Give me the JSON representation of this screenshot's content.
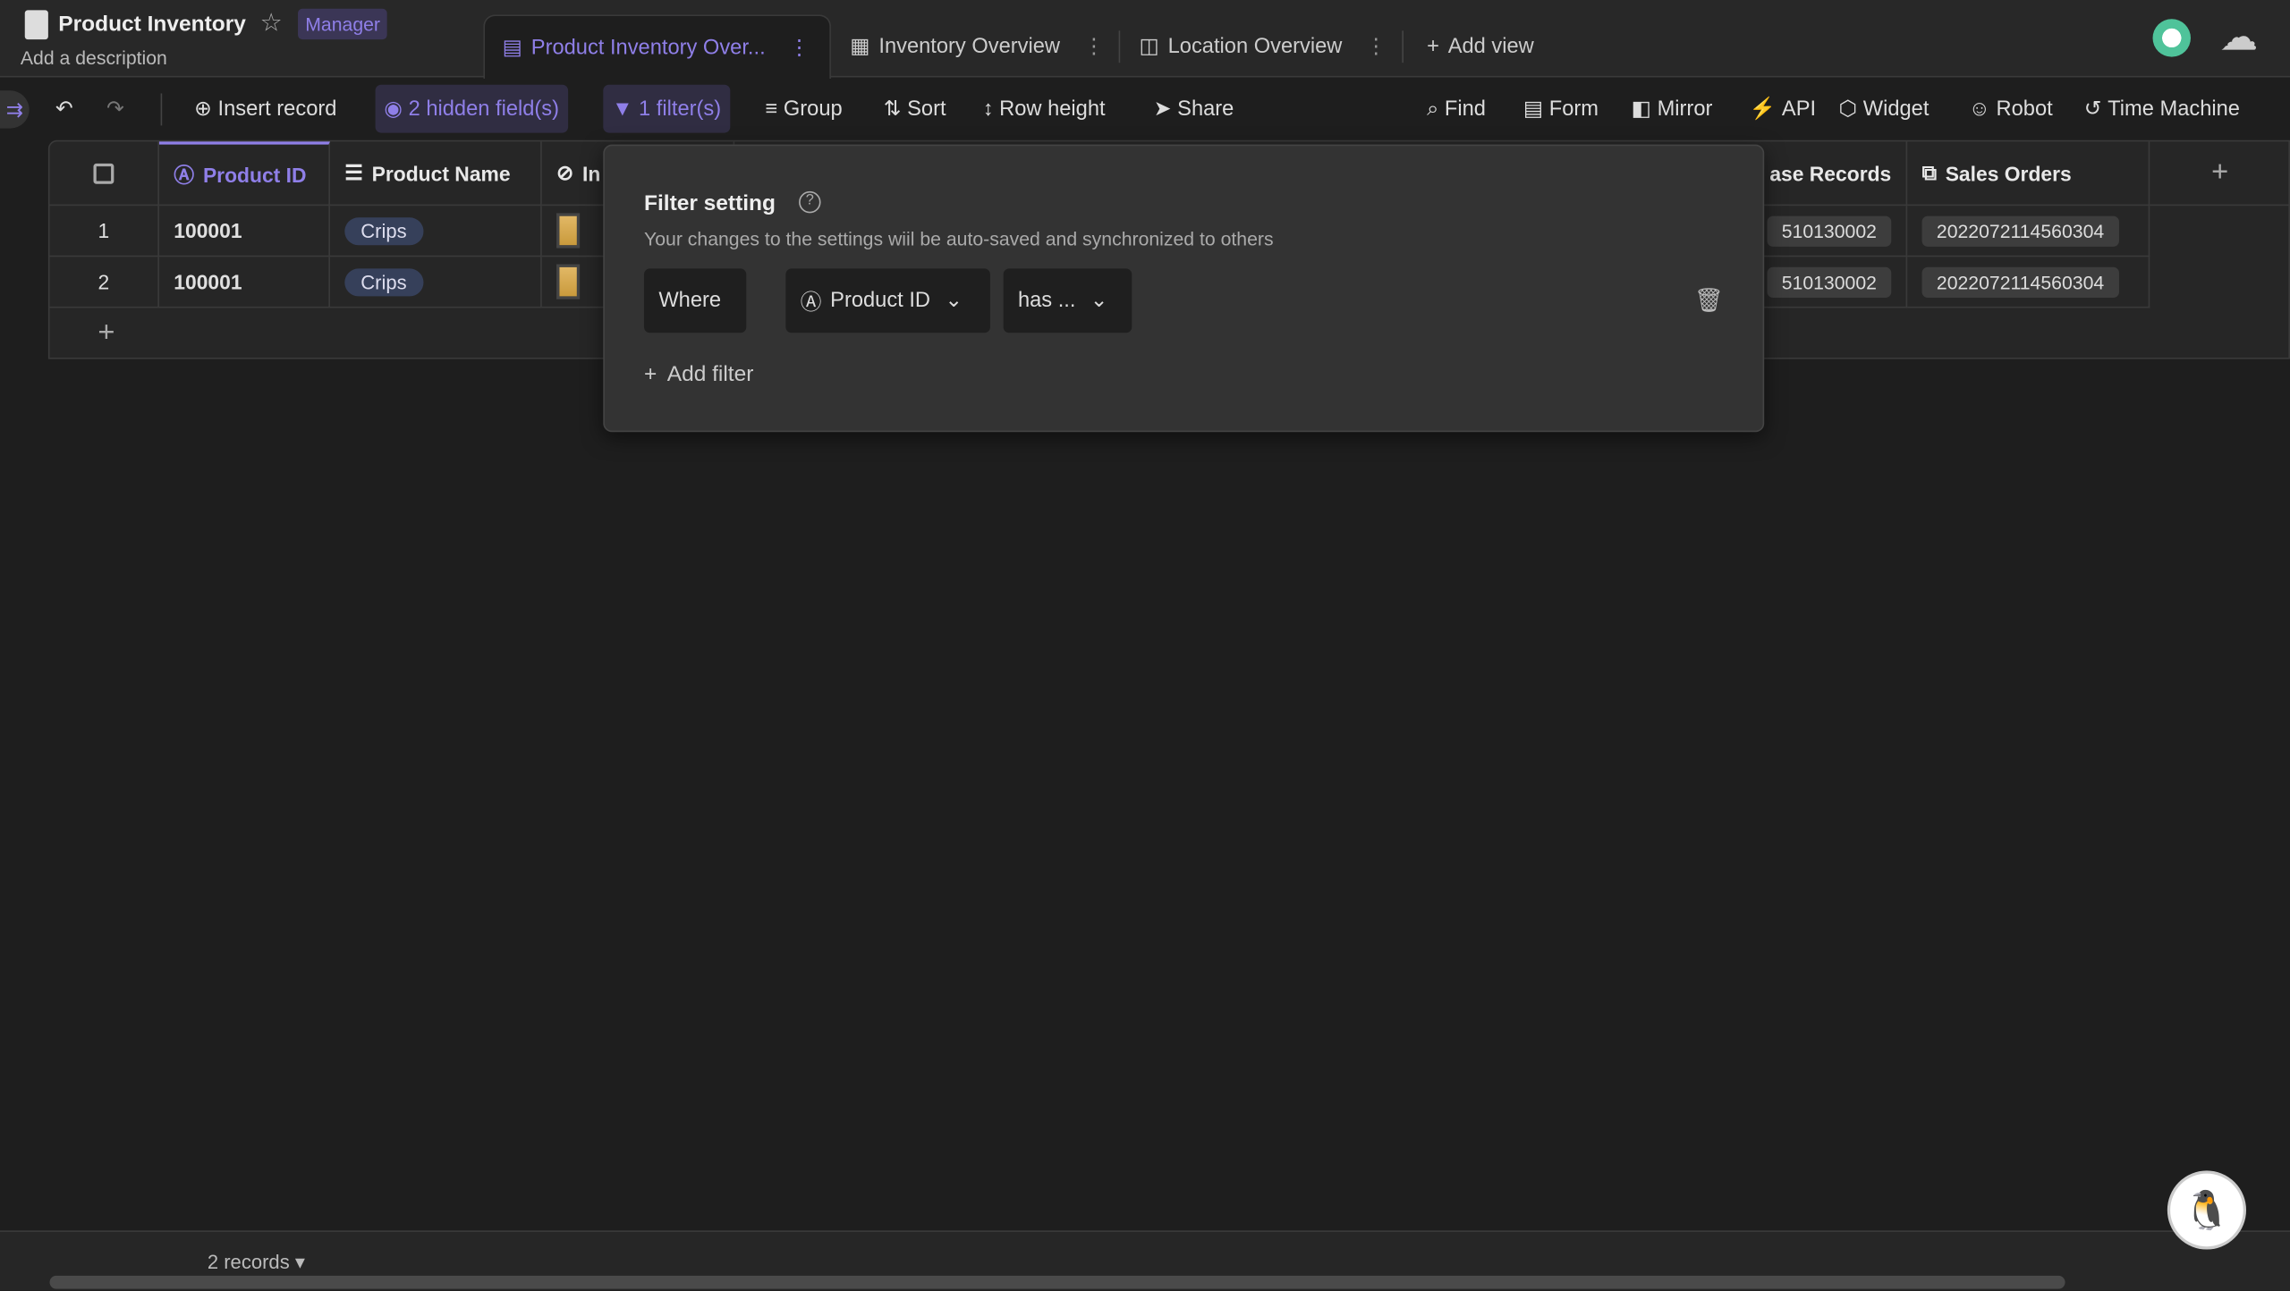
{
  "header": {
    "title": "Product Inventory",
    "role_badge": "Manager",
    "description": "Add a description"
  },
  "views": [
    {
      "label": "Product Inventory Over...",
      "active": true,
      "icon": "grid-view-icon"
    },
    {
      "label": "Inventory Overview",
      "icon": "gallery-view-icon"
    },
    {
      "label": "Location Overview",
      "icon": "kanban-view-icon"
    }
  ],
  "add_view": "Add view",
  "toolbar": {
    "insert": "Insert record",
    "hidden": "2 hidden field(s)",
    "filter": "1 filter(s)",
    "group": "Group",
    "sort": "Sort",
    "row_height": "Row height",
    "share": "Share",
    "find": "Find",
    "form": "Form",
    "mirror": "Mirror",
    "api": "API",
    "widget": "Widget",
    "robot": "Robot",
    "time_machine": "Time Machine"
  },
  "table": {
    "columns": [
      "Product ID",
      "Product Name",
      "In",
      "ase Records",
      "Sales Orders"
    ],
    "rows": [
      {
        "num": "1",
        "id": "100001",
        "name": "Crips",
        "purchase": "510130002",
        "sales": "2022072114560304"
      },
      {
        "num": "2",
        "id": "100001",
        "name": "Crips",
        "purchase": "510130002",
        "sales": "2022072114560304"
      }
    ]
  },
  "filter_popup": {
    "title": "Filter setting",
    "subtitle": "Your changes to the settings wiil be auto-saved and synchronized to others",
    "where": "Where",
    "field": "Product ID",
    "operator": "has ...",
    "add_filter": "Add filter"
  },
  "footer": {
    "records": "2 records ▾"
  },
  "colors": {
    "accent": "#8f7fe8",
    "background": "#1e1e1e"
  }
}
